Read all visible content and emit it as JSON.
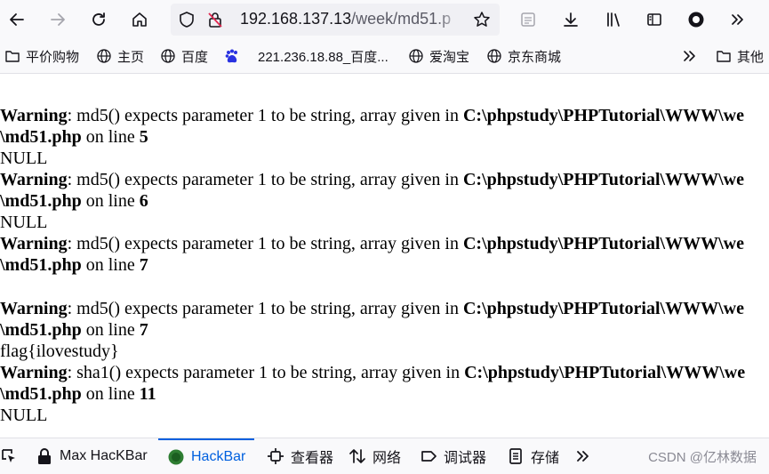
{
  "toolbar": {
    "url_host": "192.168.137.13",
    "url_path": "/week/md51.p"
  },
  "bookmarks": [
    {
      "label": "平价购物",
      "icon": "folder-icon"
    },
    {
      "label": "主页",
      "icon": "globe-icon"
    },
    {
      "label": "百度",
      "icon": "globe-icon"
    },
    {
      "label": "221.236.18.88_百度...",
      "icon": "baidu-paw-icon"
    },
    {
      "label": "爱淘宝",
      "icon": "globe-icon"
    },
    {
      "label": "京东商城",
      "icon": "globe-icon"
    },
    {
      "label": "其他",
      "icon": "folder-icon"
    }
  ],
  "content": {
    "blocks": [
      {
        "warning": "Warning",
        "msg": ": md5() expects parameter 1 to be string, array given in ",
        "path": "C:\\phpstudy\\PHPTutorial\\WWW\\we",
        "file": "\\md51.php",
        "on_line": " on line ",
        "line_no": "5"
      },
      {
        "warning": "Warning",
        "msg": ": md5() expects parameter 1 to be string, array given in ",
        "path": "C:\\phpstudy\\PHPTutorial\\WWW\\we",
        "file": "\\md51.php",
        "on_line": " on line ",
        "line_no": "6"
      },
      {
        "warning": "Warning",
        "msg": ": md5() expects parameter 1 to be string, array given in ",
        "path": "C:\\phpstudy\\PHPTutorial\\WWW\\we",
        "file": "\\md51.php",
        "on_line": " on line ",
        "line_no": "7"
      },
      {
        "warning": "Warning",
        "msg": ": md5() expects parameter 1 to be string, array given in ",
        "path": "C:\\phpstudy\\PHPTutorial\\WWW\\we",
        "file": "\\md51.php",
        "on_line": " on line ",
        "line_no": "7"
      },
      {
        "warning": "Warning",
        "msg": ": sha1() expects parameter 1 to be string, array given in ",
        "path": "C:\\phpstudy\\PHPTutorial\\WWW\\we",
        "file": "\\md51.php",
        "on_line": " on line ",
        "line_no": "11"
      }
    ],
    "null_text": "NULL",
    "flag_text": "flag{ilovestudy}"
  },
  "devtools": {
    "tabs": [
      {
        "label": "Max HacKBar",
        "icon": "lock-icon"
      },
      {
        "label": "HackBar",
        "icon": "hackbar-icon"
      },
      {
        "label": "查看器",
        "icon": "inspector-icon"
      },
      {
        "label": "网络",
        "icon": "network-icon"
      },
      {
        "label": "调试器",
        "icon": "debugger-icon"
      },
      {
        "label": "存储",
        "icon": "storage-icon"
      }
    ],
    "watermark": "CSDN @亿林数据"
  },
  "colors": {
    "accent": "#0060df",
    "toolbar_bg": "#f9f9fb",
    "urlbar_bg": "#f0f0f4"
  }
}
